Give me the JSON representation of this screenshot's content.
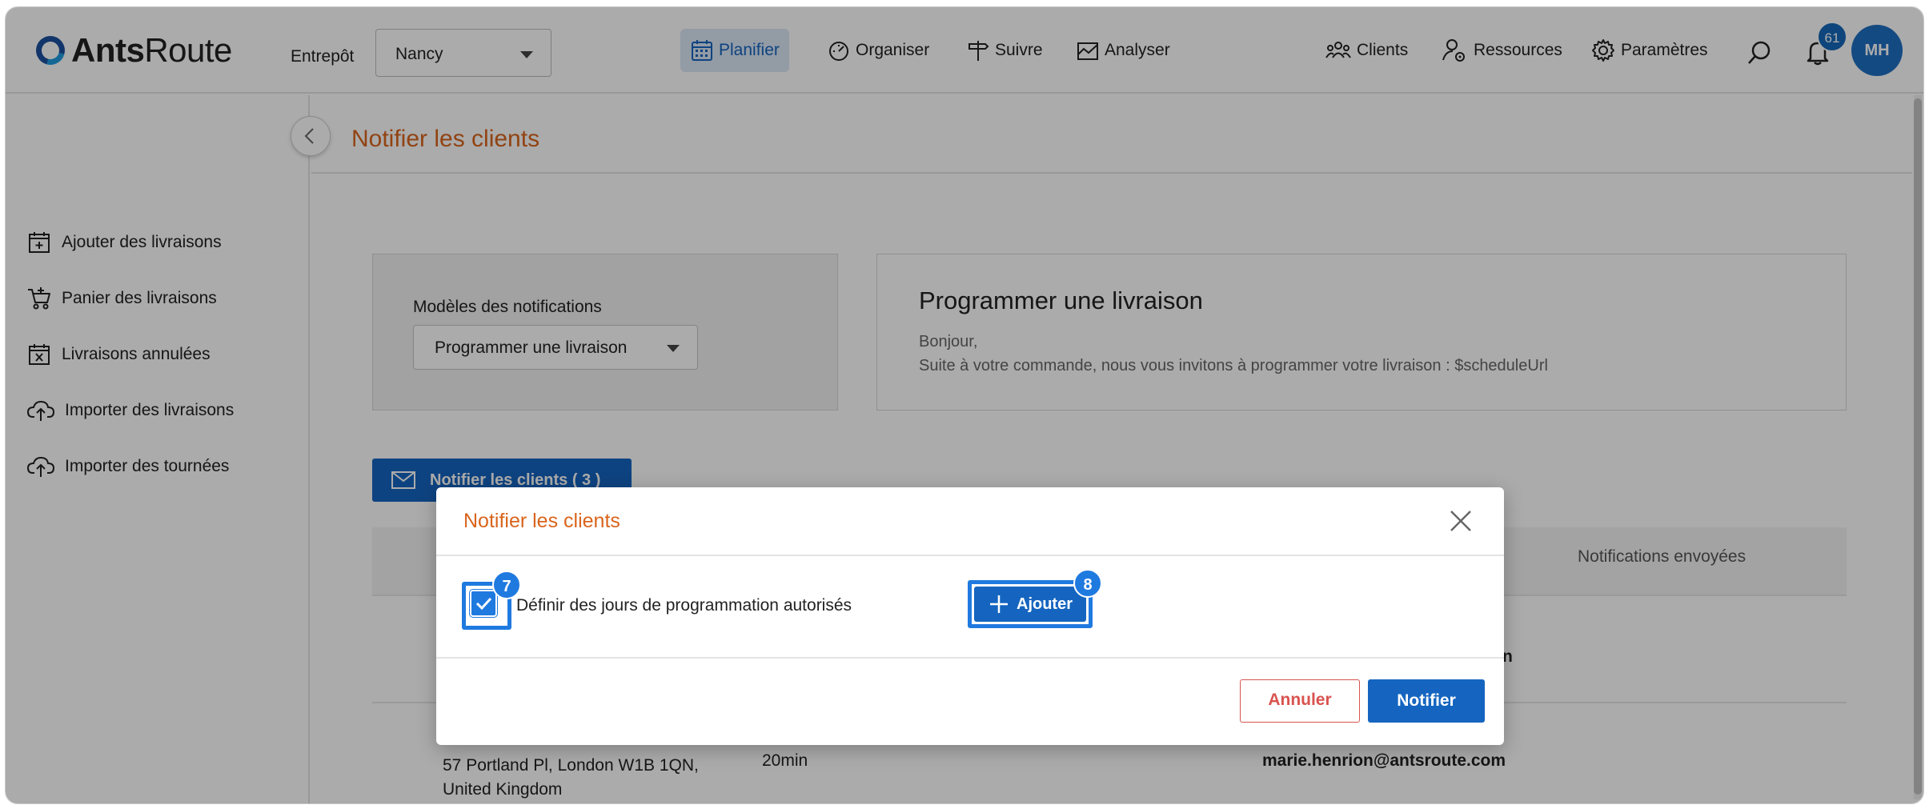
{
  "app": {
    "logo_bold": "Ants",
    "logo_light": "Route"
  },
  "header": {
    "warehouse_label": "Entrepôt",
    "warehouse_value": "Nancy",
    "nav": [
      {
        "label": "Planifier",
        "icon": "calendar-icon",
        "active": true
      },
      {
        "label": "Organiser",
        "icon": "gauge-icon"
      },
      {
        "label": "Suivre",
        "icon": "signpost-icon"
      },
      {
        "label": "Analyser",
        "icon": "chart-icon"
      },
      {
        "label": "Clients",
        "icon": "users-icon"
      },
      {
        "label": "Ressources",
        "icon": "user-gear-icon"
      },
      {
        "label": "Paramètres",
        "icon": "gear-icon"
      }
    ],
    "notification_count": "61",
    "avatar_initials": "MH"
  },
  "sidebar": {
    "items": [
      {
        "label": "Ajouter des livraisons",
        "icon": "calendar-add-icon"
      },
      {
        "label": "Panier des livraisons",
        "icon": "cart-icon"
      },
      {
        "label": "Livraisons annulées",
        "icon": "calendar-cancel-icon"
      },
      {
        "label": "Importer des livraisons",
        "icon": "cloud-upload-icon"
      },
      {
        "label": "Importer des tournées",
        "icon": "cloud-upload-icon"
      }
    ]
  },
  "main": {
    "title": "Notifier les clients",
    "template_label": "Modèles des notifications",
    "template_value": "Programmer une livraison",
    "preview_title": "Programmer une livraison",
    "preview_body": "Bonjour,\nSuite à votre commande, nous vous invitons à programmer votre livraison :  $scheduleUrl",
    "notify_button": "Notifier les clients ( 3 )",
    "table_header_notifications": "Notifications envoyées",
    "row1_email_partial": "n",
    "row2_address": "57 Portland Pl, London W1B 1QN,",
    "row2_address_line2": "United Kingdom",
    "row2_duration": "20min",
    "row2_email": "marie.henrion@antsroute.com"
  },
  "modal": {
    "title": "Notifier les clients",
    "checkbox_label": "Définir des jours de programmation autorisés",
    "checkbox_checked": true,
    "add_button": "Ajouter",
    "cancel_button": "Annuler",
    "confirm_button": "Notifier",
    "step_checkbox": "7",
    "step_add": "8"
  },
  "colors": {
    "accent": "#1565c0",
    "title_orange": "#d9641c",
    "cancel_red": "#d9534f",
    "highlight_blue": "#1f7ae0"
  }
}
